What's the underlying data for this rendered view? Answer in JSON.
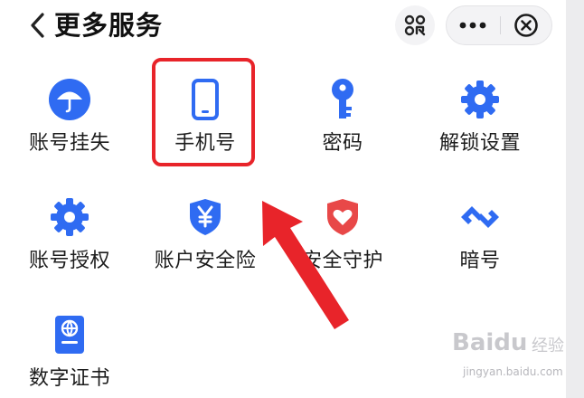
{
  "header": {
    "back_icon": "chevron-left-icon",
    "title": "更多服务",
    "scan_icon": "scan-code-icon",
    "more_icon": "more-dots-icon",
    "close_icon": "close-circle-icon"
  },
  "services": [
    {
      "label": "账号挂失",
      "icon": "umbrella-icon",
      "color": "#2f6bf2"
    },
    {
      "label": "手机号",
      "icon": "phone-icon",
      "color": "#2f6bf2",
      "highlighted": true
    },
    {
      "label": "密码",
      "icon": "key-icon",
      "color": "#2f6bf2"
    },
    {
      "label": "解锁设置",
      "icon": "gear-icon",
      "color": "#2f6bf2"
    },
    {
      "label": "账号授权",
      "icon": "gear-icon",
      "color": "#2f6bf2"
    },
    {
      "label": "账户安全险",
      "icon": "yen-shield-icon",
      "color": "#2f6bf2"
    },
    {
      "label": "安全守护",
      "icon": "heart-shield-icon",
      "color": "#e84848"
    },
    {
      "label": "暗号",
      "icon": "link-icon",
      "color": "#2f6bf2"
    },
    {
      "label": "数字证书",
      "icon": "passport-icon",
      "color": "#2f6bf2"
    }
  ],
  "annotation": {
    "highlight_color": "#e8242a",
    "arrow_color": "#e8242a"
  },
  "watermark": {
    "brand": "Baidu",
    "product": "经验",
    "url": "jingyan.baidu.com"
  }
}
